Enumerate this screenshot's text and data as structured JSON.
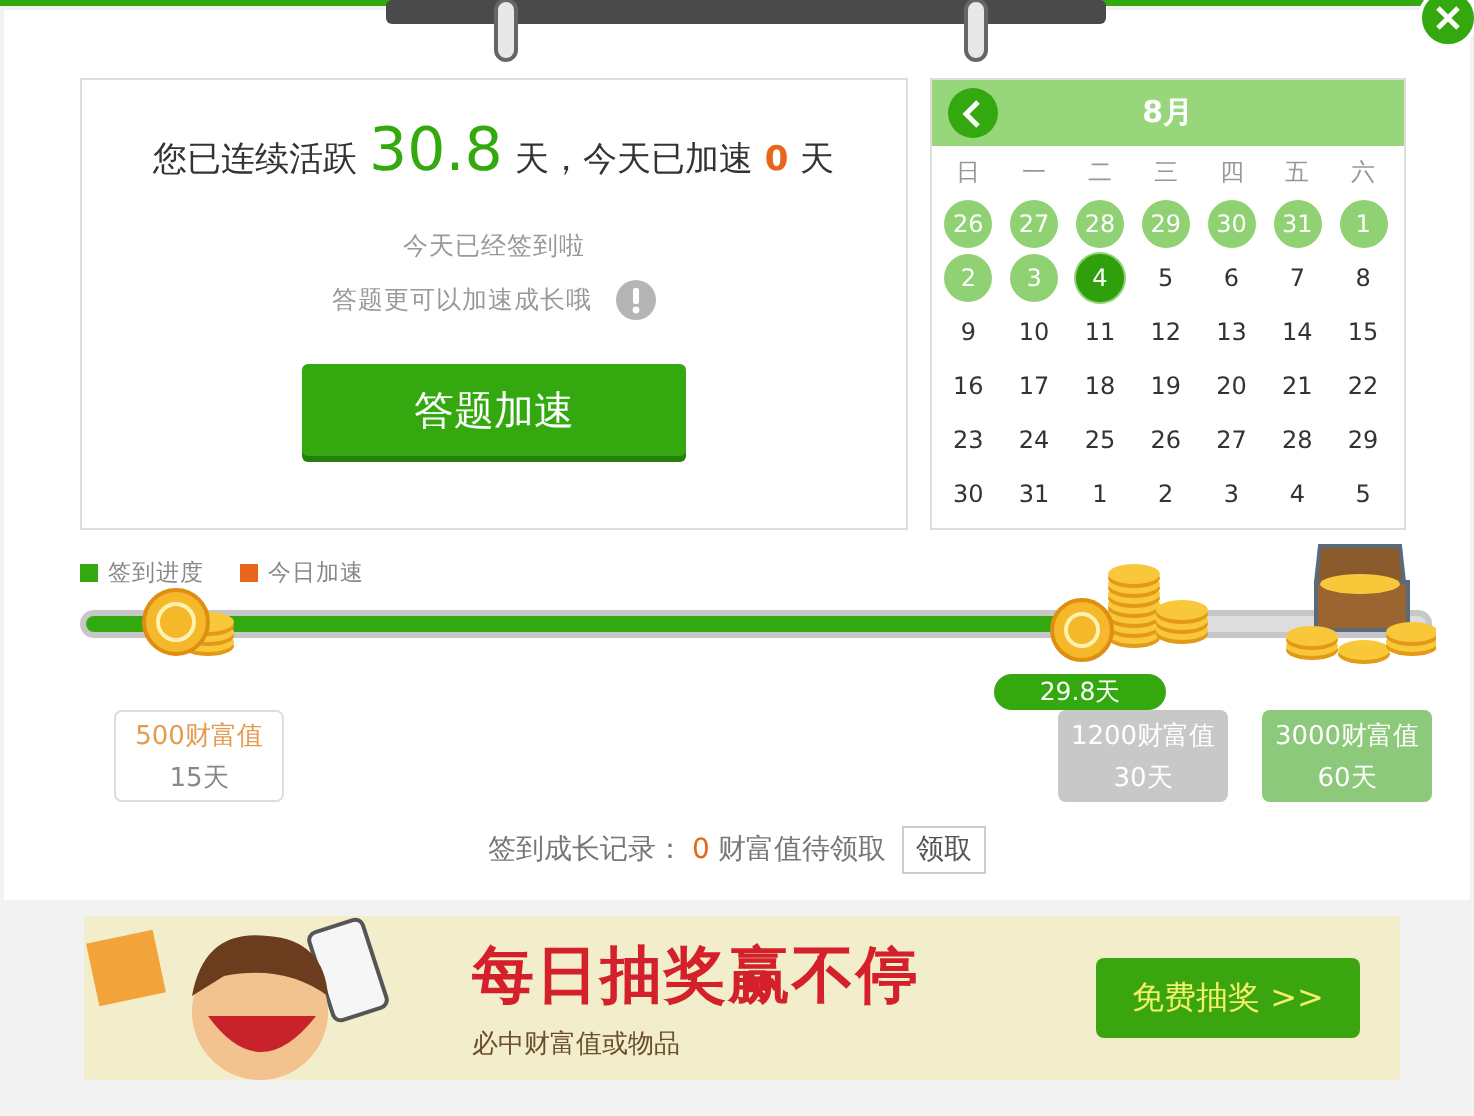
{
  "summary": {
    "prefix": "您已连续活跃",
    "days": "30.8",
    "middle": "天，今天已加速",
    "boost": "0",
    "suffix": "天"
  },
  "notes": [
    "今天已经签到啦",
    "答题更可以加速成长哦"
  ],
  "answer_button": "答题加速",
  "calendar": {
    "month": "8月",
    "weekdays": [
      "日",
      "一",
      "二",
      "三",
      "四",
      "五",
      "六"
    ],
    "days": [
      {
        "label": "26",
        "signed": true,
        "selected": false
      },
      {
        "label": "27",
        "signed": true,
        "selected": false
      },
      {
        "label": "28",
        "signed": true,
        "selected": false
      },
      {
        "label": "29",
        "signed": true,
        "selected": false
      },
      {
        "label": "30",
        "signed": true,
        "selected": false
      },
      {
        "label": "31",
        "signed": true,
        "selected": false
      },
      {
        "label": "1",
        "signed": true,
        "selected": false
      },
      {
        "label": "2",
        "signed": true,
        "selected": false
      },
      {
        "label": "3",
        "signed": true,
        "selected": false
      },
      {
        "label": "4",
        "signed": true,
        "selected": true
      },
      {
        "label": "5",
        "signed": false,
        "selected": false
      },
      {
        "label": "6",
        "signed": false,
        "selected": false
      },
      {
        "label": "7",
        "signed": false,
        "selected": false
      },
      {
        "label": "8",
        "signed": false,
        "selected": false
      },
      {
        "label": "9",
        "signed": false,
        "selected": false
      },
      {
        "label": "10",
        "signed": false,
        "selected": false
      },
      {
        "label": "11",
        "signed": false,
        "selected": false
      },
      {
        "label": "12",
        "signed": false,
        "selected": false
      },
      {
        "label": "13",
        "signed": false,
        "selected": false
      },
      {
        "label": "14",
        "signed": false,
        "selected": false
      },
      {
        "label": "15",
        "signed": false,
        "selected": false
      },
      {
        "label": "16",
        "signed": false,
        "selected": false
      },
      {
        "label": "17",
        "signed": false,
        "selected": false
      },
      {
        "label": "18",
        "signed": false,
        "selected": false
      },
      {
        "label": "19",
        "signed": false,
        "selected": false
      },
      {
        "label": "20",
        "signed": false,
        "selected": false
      },
      {
        "label": "21",
        "signed": false,
        "selected": false
      },
      {
        "label": "22",
        "signed": false,
        "selected": false
      },
      {
        "label": "23",
        "signed": false,
        "selected": false
      },
      {
        "label": "24",
        "signed": false,
        "selected": false
      },
      {
        "label": "25",
        "signed": false,
        "selected": false
      },
      {
        "label": "26",
        "signed": false,
        "selected": false
      },
      {
        "label": "27",
        "signed": false,
        "selected": false
      },
      {
        "label": "28",
        "signed": false,
        "selected": false
      },
      {
        "label": "29",
        "signed": false,
        "selected": false
      },
      {
        "label": "30",
        "signed": false,
        "selected": false
      },
      {
        "label": "31",
        "signed": false,
        "selected": false
      },
      {
        "label": "1",
        "signed": false,
        "selected": false
      },
      {
        "label": "2",
        "signed": false,
        "selected": false
      },
      {
        "label": "3",
        "signed": false,
        "selected": false
      },
      {
        "label": "4",
        "signed": false,
        "selected": false
      },
      {
        "label": "5",
        "signed": false,
        "selected": false
      }
    ]
  },
  "legend": [
    {
      "label": "签到进度",
      "color": "#33a90f"
    },
    {
      "label": "今日加速",
      "color": "#e8661c"
    }
  ],
  "progress": {
    "level": 0.74,
    "current": "29.8天"
  },
  "milestones": [
    {
      "value": "500财富值",
      "days": "15天",
      "kind": "claimed"
    },
    {
      "value": "1200财富值",
      "days": "30天",
      "kind": "locked"
    },
    {
      "value": "3000财富值",
      "days": "60天",
      "kind": "reached"
    }
  ],
  "record": {
    "label": "签到成长记录：",
    "count": "0",
    "suffix": "财富值待领取",
    "button": "领取"
  },
  "banner": {
    "headline": "每日抽奖赢不停",
    "subtitle": "必中财富值或物品",
    "button": "免费抽奖 >>"
  }
}
